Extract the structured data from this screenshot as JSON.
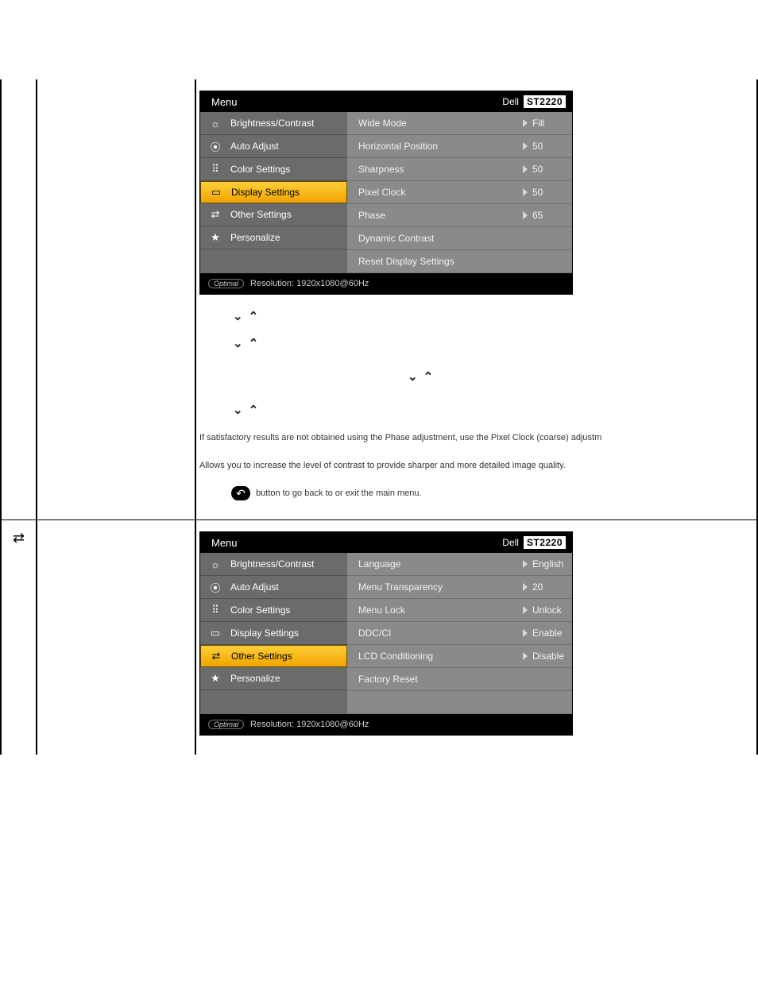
{
  "osd1": {
    "header_title": "Menu",
    "brand": "Dell",
    "model": "ST2220",
    "footer_badge": "Optimal",
    "footer_res": "Resolution: 1920x1080@60Hz",
    "nav": [
      {
        "icon": "brightness-icon",
        "glyph": "☼",
        "label": "Brightness/Contrast",
        "active": false
      },
      {
        "icon": "auto-adjust-icon",
        "glyph": "⦿",
        "label": "Auto Adjust",
        "active": false
      },
      {
        "icon": "color-settings-icon",
        "glyph": "⠿",
        "label": "Color Settings",
        "active": false
      },
      {
        "icon": "display-settings-icon",
        "glyph": "▭",
        "label": "Display Settings",
        "active": true
      },
      {
        "icon": "other-settings-icon",
        "glyph": "⇄",
        "label": "Other Settings",
        "active": false
      },
      {
        "icon": "personalize-icon",
        "glyph": "★",
        "label": "Personalize",
        "active": false
      }
    ],
    "options": [
      {
        "label": "Wide Mode",
        "value": "Fill"
      },
      {
        "label": "Horizontal Position",
        "value": "50"
      },
      {
        "label": "Sharpness",
        "value": "50"
      },
      {
        "label": "Pixel Clock",
        "value": "50"
      },
      {
        "label": "Phase",
        "value": "65"
      },
      {
        "label": "Dynamic Contrast",
        "value": ""
      },
      {
        "label": "Reset Display Settings",
        "value": ""
      }
    ]
  },
  "text": {
    "phase_note": "If satisfactory results are not obtained using the Phase adjustment, use the Pixel Clock (coarse) adjustm",
    "dyn_contrast": "Allows you to increase the level of contrast to provide sharper and more detailed image quality.",
    "back_note": " button to go back to or exit the main menu."
  },
  "osd2": {
    "header_title": "Menu",
    "brand": "Dell",
    "model": "ST2220",
    "footer_badge": "Optimal",
    "footer_res": "Resolution: 1920x1080@60Hz",
    "nav": [
      {
        "icon": "brightness-icon",
        "glyph": "☼",
        "label": "Brightness/Contrast",
        "active": false
      },
      {
        "icon": "auto-adjust-icon",
        "glyph": "⦿",
        "label": "Auto Adjust",
        "active": false
      },
      {
        "icon": "color-settings-icon",
        "glyph": "⠿",
        "label": "Color Settings",
        "active": false
      },
      {
        "icon": "display-settings-icon",
        "glyph": "▭",
        "label": "Display Settings",
        "active": false
      },
      {
        "icon": "other-settings-icon",
        "glyph": "⇄",
        "label": "Other Settings",
        "active": true
      },
      {
        "icon": "personalize-icon",
        "glyph": "★",
        "label": "Personalize",
        "active": false
      }
    ],
    "options": [
      {
        "label": "Language",
        "value": "English"
      },
      {
        "label": "Menu Transparency",
        "value": "20"
      },
      {
        "label": "Menu Lock",
        "value": "Unlock"
      },
      {
        "label": "DDC/CI",
        "value": "Enable"
      },
      {
        "label": "LCD Conditioning",
        "value": "Disable"
      },
      {
        "label": "Factory Reset",
        "value": ""
      },
      {
        "label": "",
        "value": ""
      }
    ]
  }
}
